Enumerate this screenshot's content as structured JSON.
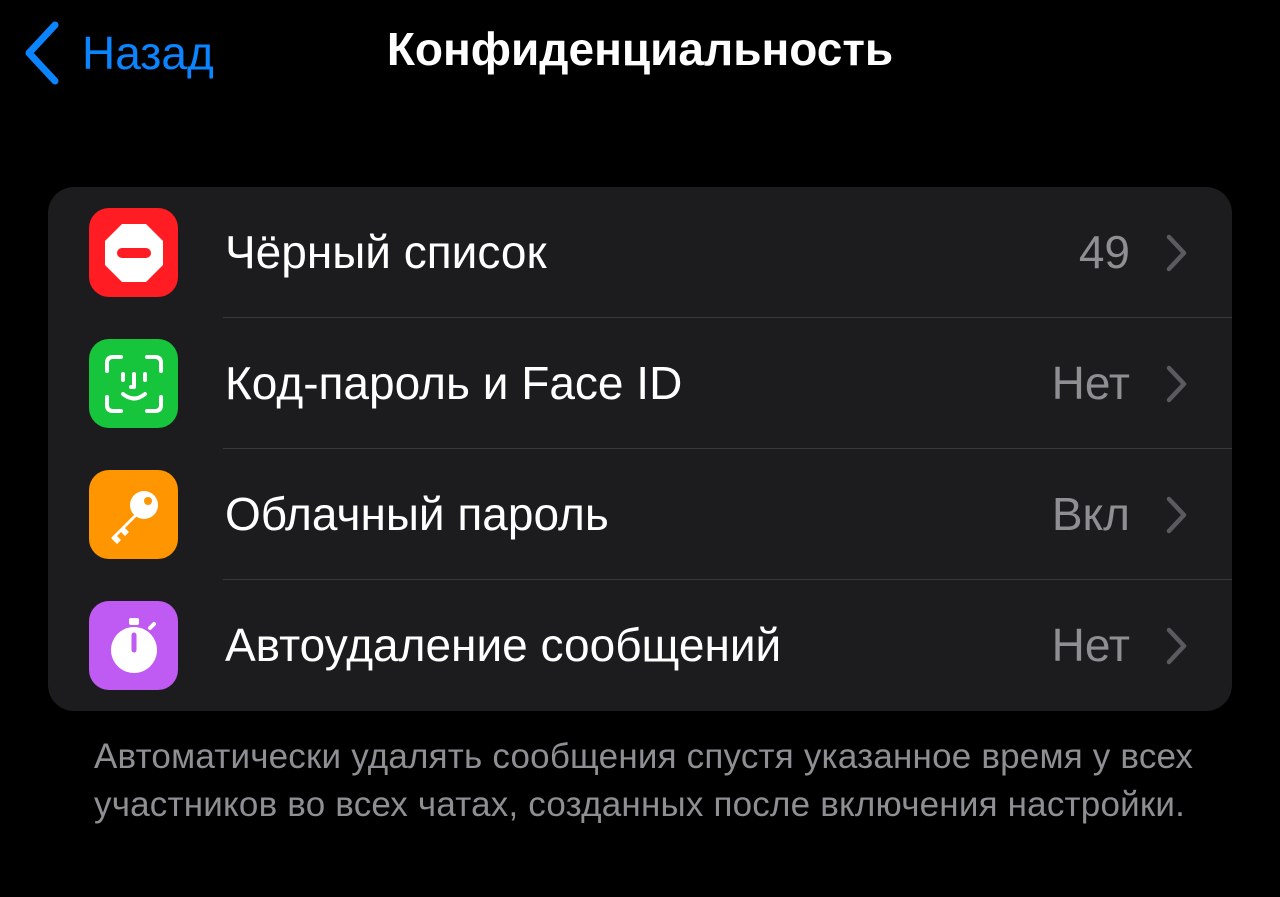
{
  "nav": {
    "back_label": "Назад",
    "title": "Конфиденциальность"
  },
  "settings": [
    {
      "label": "Чёрный список",
      "value": "49",
      "icon": "no-entry-icon",
      "icon_color": "#FF1C23"
    },
    {
      "label": "Код-пароль и Face ID",
      "value": "Нет",
      "icon": "face-id-icon",
      "icon_color": "#17C53D"
    },
    {
      "label": "Облачный пароль",
      "value": "Вкл",
      "icon": "key-icon",
      "icon_color": "#FF9500"
    },
    {
      "label": "Автоудаление сообщений",
      "value": "Нет",
      "icon": "timer-icon",
      "icon_color": "#BF5AF2"
    }
  ],
  "footer_text": "Автоматически удалять сообщения спустя указанное время у всех участников во всех чатах, созданных после включения настройки.",
  "colors": {
    "background": "#000000",
    "group_background": "#1C1C1E",
    "accent": "#0A84FF",
    "secondary_text": "#8E8E93",
    "separator": "#38383A"
  }
}
